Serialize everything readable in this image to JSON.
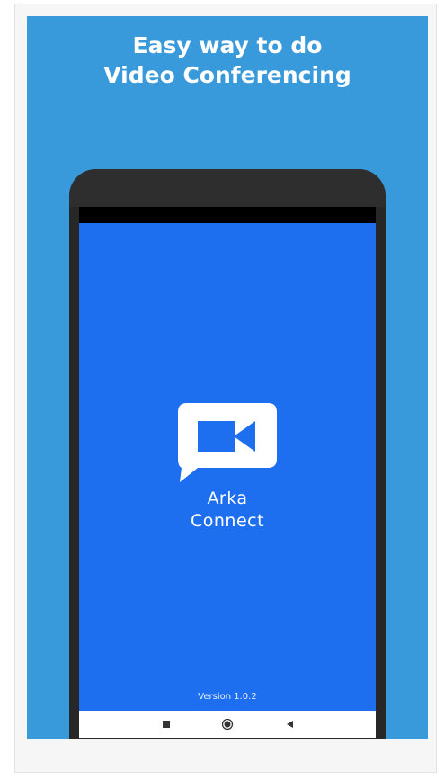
{
  "banner": {
    "headline_line1": "Easy way to do",
    "headline_line2": "Video Conferencing",
    "background_color": "#3899db"
  },
  "phone_screen": {
    "background_color": "#1e6ff0",
    "logo_icon": "video-camera-chat-bubble-icon",
    "app_name_line1": "Arka",
    "app_name_line2": "Connect",
    "version_text": "Version 1.0.2"
  },
  "navbar": {
    "items": [
      "recent-apps-icon",
      "home-icon",
      "back-icon"
    ]
  }
}
